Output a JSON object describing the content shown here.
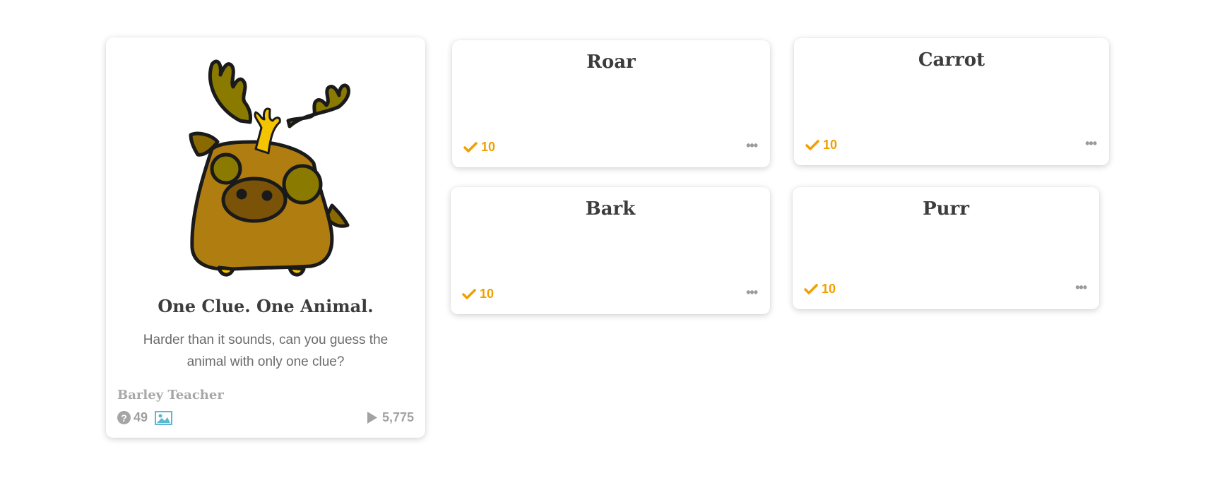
{
  "main_card": {
    "title": "One Clue. One Animal.",
    "description": "Harder than it sounds, can you guess the animal with only one clue?",
    "author": "Barley Teacher",
    "question_count": "49",
    "plays": "5,775",
    "image_icon": "moose-illustration"
  },
  "questions": [
    {
      "title": "Roar",
      "points": "10"
    },
    {
      "title": "Carrot",
      "points": "10"
    },
    {
      "title": "Bark",
      "points": "10"
    },
    {
      "title": "Purr",
      "points": "10"
    }
  ],
  "colors": {
    "accent": "#f0a000",
    "text": "#3c3c3c",
    "muted": "#a8a8a8"
  }
}
